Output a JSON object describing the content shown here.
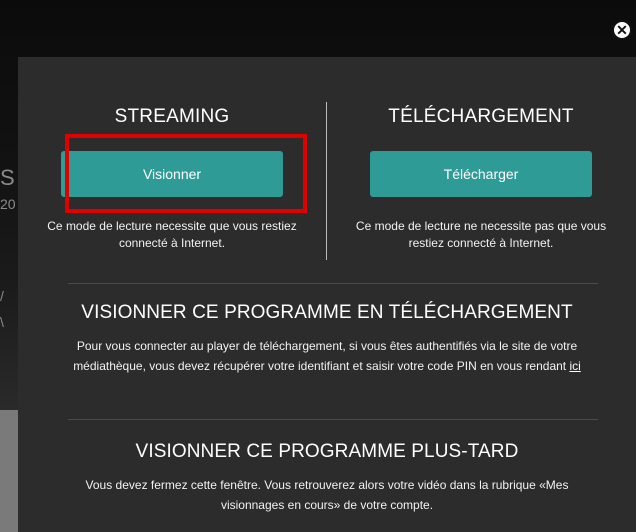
{
  "close": {
    "glyph": "✕"
  },
  "streaming": {
    "title": "STREAMING",
    "button_label": "Visionner",
    "description": "Ce mode de lecture necessite que vous restiez connecté à Internet."
  },
  "download": {
    "title": "TÉLÉCHARGEMENT",
    "button_label": "Télécharger",
    "description": "Ce mode de lecture ne necessite pas que vous restiez connecté à Internet."
  },
  "download_program": {
    "title": "VISIONNER CE PROGRAMME EN TÉLÉCHARGEMENT",
    "text_before": "Pour vous connecter au player de téléchargement, si vous êtes authentifiés via le site de votre médiathèque, vous devez récupérer votre identifiant et saisir votre code PIN en vous rendant ",
    "link_label": "ici"
  },
  "later": {
    "title": "VISIONNER CE PROGRAMME PLUS-TARD",
    "text": "Vous devez fermez cette fenêtre. Vous retrouverez alors votre vidéo dans la rubrique «Mes visionnages en cours» de votre compte."
  },
  "background": {
    "glyphs": [
      "S",
      "20",
      "/",
      "\\"
    ]
  },
  "colors": {
    "modal_bg": "#2c2c2c",
    "button": "#2f9b96",
    "highlight": "#e00000"
  }
}
